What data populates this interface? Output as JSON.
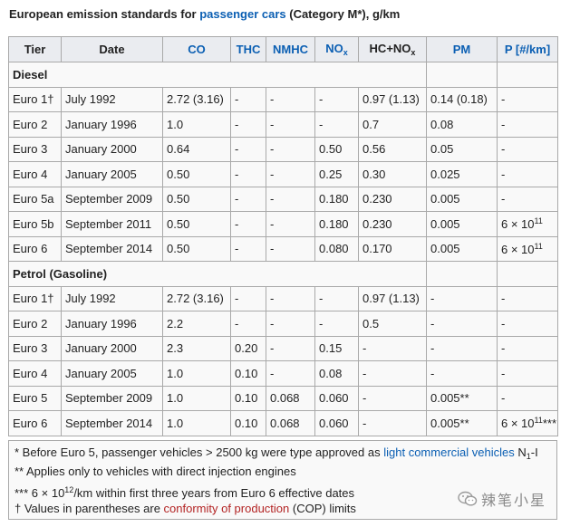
{
  "caption": {
    "prefix": "European emission standards for ",
    "link": "passenger cars",
    "suffix": " (Category M*), g/km"
  },
  "headers": {
    "tier": "Tier",
    "date": "Date",
    "co": "CO",
    "thc": "THC",
    "nmhc": "NMHC",
    "nox_main": "NO",
    "nox_sub": "x",
    "hcnox_main": "HC+NO",
    "hcnox_sub": "x",
    "pm": "PM",
    "p": "P [#/km]"
  },
  "sections": [
    {
      "name": "Diesel",
      "rows": [
        {
          "tier": "Euro 1†",
          "date": "July 1992",
          "co": "2.72 (3.16)",
          "thc": "-",
          "nmhc": "-",
          "nox": "-",
          "hcnox": "0.97 (1.13)",
          "pm": "0.14 (0.18)",
          "p_base": "-",
          "p_exp": "",
          "p_suffix": ""
        },
        {
          "tier": "Euro 2",
          "date": "January 1996",
          "co": "1.0",
          "thc": "-",
          "nmhc": "-",
          "nox": "-",
          "hcnox": "0.7",
          "pm": "0.08",
          "p_base": "-",
          "p_exp": "",
          "p_suffix": ""
        },
        {
          "tier": "Euro 3",
          "date": "January 2000",
          "co": "0.64",
          "thc": "-",
          "nmhc": "-",
          "nox": "0.50",
          "hcnox": "0.56",
          "pm": "0.05",
          "p_base": "-",
          "p_exp": "",
          "p_suffix": ""
        },
        {
          "tier": "Euro 4",
          "date": "January 2005",
          "co": "0.50",
          "thc": "-",
          "nmhc": "-",
          "nox": "0.25",
          "hcnox": "0.30",
          "pm": "0.025",
          "p_base": "-",
          "p_exp": "",
          "p_suffix": ""
        },
        {
          "tier": "Euro 5a",
          "date": "September 2009",
          "co": "0.50",
          "thc": "-",
          "nmhc": "-",
          "nox": "0.180",
          "hcnox": "0.230",
          "pm": "0.005",
          "p_base": "-",
          "p_exp": "",
          "p_suffix": ""
        },
        {
          "tier": "Euro 5b",
          "date": "September 2011",
          "co": "0.50",
          "thc": "-",
          "nmhc": "-",
          "nox": "0.180",
          "hcnox": "0.230",
          "pm": "0.005",
          "p_base": "6 × 10",
          "p_exp": "11",
          "p_suffix": ""
        },
        {
          "tier": "Euro 6",
          "date": "September 2014",
          "co": "0.50",
          "thc": "-",
          "nmhc": "-",
          "nox": "0.080",
          "hcnox": "0.170",
          "pm": "0.005",
          "p_base": "6 × 10",
          "p_exp": "11",
          "p_suffix": ""
        }
      ]
    },
    {
      "name": "Petrol (Gasoline)",
      "rows": [
        {
          "tier": "Euro 1†",
          "date": "July 1992",
          "co": "2.72 (3.16)",
          "thc": "-",
          "nmhc": "-",
          "nox": "-",
          "hcnox": "0.97 (1.13)",
          "pm": "-",
          "p_base": "-",
          "p_exp": "",
          "p_suffix": ""
        },
        {
          "tier": "Euro 2",
          "date": "January 1996",
          "co": "2.2",
          "thc": "-",
          "nmhc": "-",
          "nox": "-",
          "hcnox": "0.5",
          "pm": "-",
          "p_base": "-",
          "p_exp": "",
          "p_suffix": ""
        },
        {
          "tier": "Euro 3",
          "date": "January 2000",
          "co": "2.3",
          "thc": "0.20",
          "nmhc": "-",
          "nox": "0.15",
          "hcnox": "-",
          "pm": "-",
          "p_base": "-",
          "p_exp": "",
          "p_suffix": ""
        },
        {
          "tier": "Euro 4",
          "date": "January 2005",
          "co": "1.0",
          "thc": "0.10",
          "nmhc": "-",
          "nox": "0.08",
          "hcnox": "-",
          "pm": "-",
          "p_base": "-",
          "p_exp": "",
          "p_suffix": ""
        },
        {
          "tier": "Euro 5",
          "date": "September 2009",
          "co": "1.0",
          "thc": "0.10",
          "nmhc": "0.068",
          "nox": "0.060",
          "hcnox": "-",
          "pm": "0.005**",
          "p_base": "-",
          "p_exp": "",
          "p_suffix": ""
        },
        {
          "tier": "Euro 6",
          "date": "September 2014",
          "co": "1.0",
          "thc": "0.10",
          "nmhc": "0.068",
          "nox": "0.060",
          "hcnox": "-",
          "pm": "0.005**",
          "p_base": "6 × 10",
          "p_exp": "11",
          "p_suffix": "***"
        }
      ]
    }
  ],
  "notes": {
    "n1_pre": "* Before Euro 5, passenger vehicles > 2500 kg were type approved as ",
    "n1_link": "light commercial vehicles",
    "n1_post": " N",
    "n1_sub": "1",
    "n1_tail": "-I",
    "n2": "** Applies only to vehicles with direct injection engines",
    "n3_pre": "*** 6 × 10",
    "n3_sup": "12",
    "n3_post": "/km within first three years from Euro 6 effective dates",
    "n4_pre": "† Values in parentheses are ",
    "n4_link": "conformity of production",
    "n4_post": " (COP) limits"
  },
  "watermark": {
    "text": "辣笔小星",
    "icon": "wechat-icon"
  },
  "colors": {
    "link": "#0b5fb3",
    "red_link": "#b32424",
    "header_bg": "#eaecf0",
    "cell_bg": "#f9f9f9",
    "border": "#a9a9a9"
  }
}
